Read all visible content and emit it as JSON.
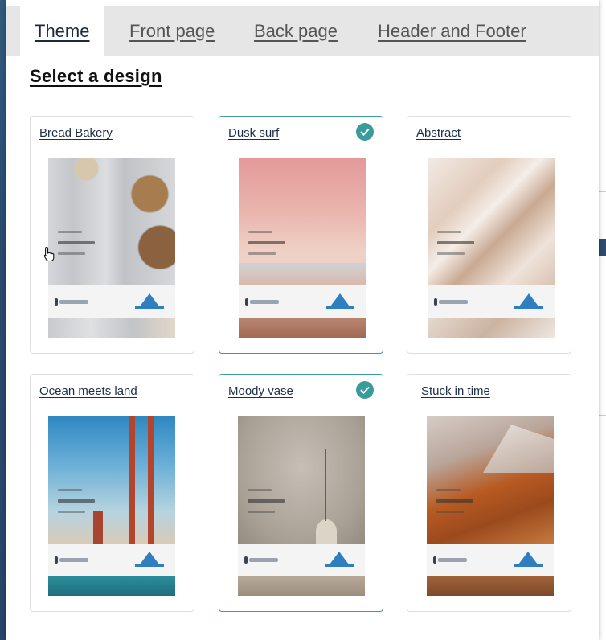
{
  "tabs": [
    {
      "label": "Theme",
      "active": true
    },
    {
      "label": "Front page",
      "active": false
    },
    {
      "label": "Back page",
      "active": false
    },
    {
      "label": "Header and Footer",
      "active": false
    }
  ],
  "section_title": "Select a design",
  "designs": [
    {
      "name": "Bread Bakery",
      "selected": false,
      "thumbnail_palette": [
        "#c9ccd0",
        "#9c7b55",
        "#dcdde0"
      ]
    },
    {
      "name": "Dusk surf",
      "selected": true,
      "thumbnail_palette": [
        "#e6a6a4",
        "#e9c8bd",
        "#b07b66"
      ]
    },
    {
      "name": "Abstract",
      "selected": false,
      "thumbnail_palette": [
        "#efe4dc",
        "#c8a990",
        "#e5d7cc"
      ]
    },
    {
      "name": "Ocean meets land",
      "selected": false,
      "thumbnail_palette": [
        "#3d8fc4",
        "#b74a32",
        "#2a7a8a"
      ]
    },
    {
      "name": "Moody vase",
      "selected": true,
      "thumbnail_palette": [
        "#b9b1a7",
        "#8f8579",
        "#a89987"
      ]
    },
    {
      "name": "Stuck in time",
      "selected": false,
      "thumbnail_palette": [
        "#c9b9b2",
        "#b85a22",
        "#8f5634"
      ]
    }
  ],
  "colors": {
    "accent": "#3a9b9b",
    "link": "#1e2e4a"
  }
}
